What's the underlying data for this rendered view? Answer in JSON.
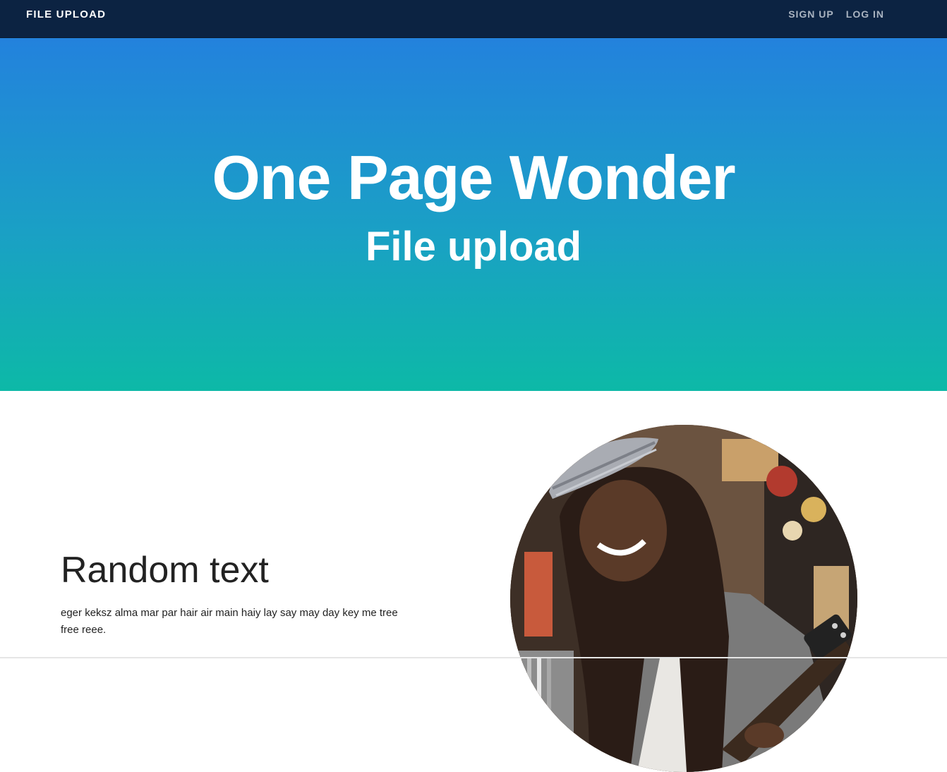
{
  "navbar": {
    "brand": "FILE UPLOAD",
    "links": [
      "SIGN UP",
      "LOG IN"
    ]
  },
  "hero": {
    "title": "One Page Wonder",
    "subtitle": "File upload"
  },
  "section": {
    "heading": "Random text",
    "body": "eger keksz alma mar par hair air main haiy lay say may day key me tree free reee."
  },
  "colors": {
    "navbar": "#0c2342",
    "hero_top": "#2382dd",
    "hero_bottom": "#0db9a7"
  }
}
